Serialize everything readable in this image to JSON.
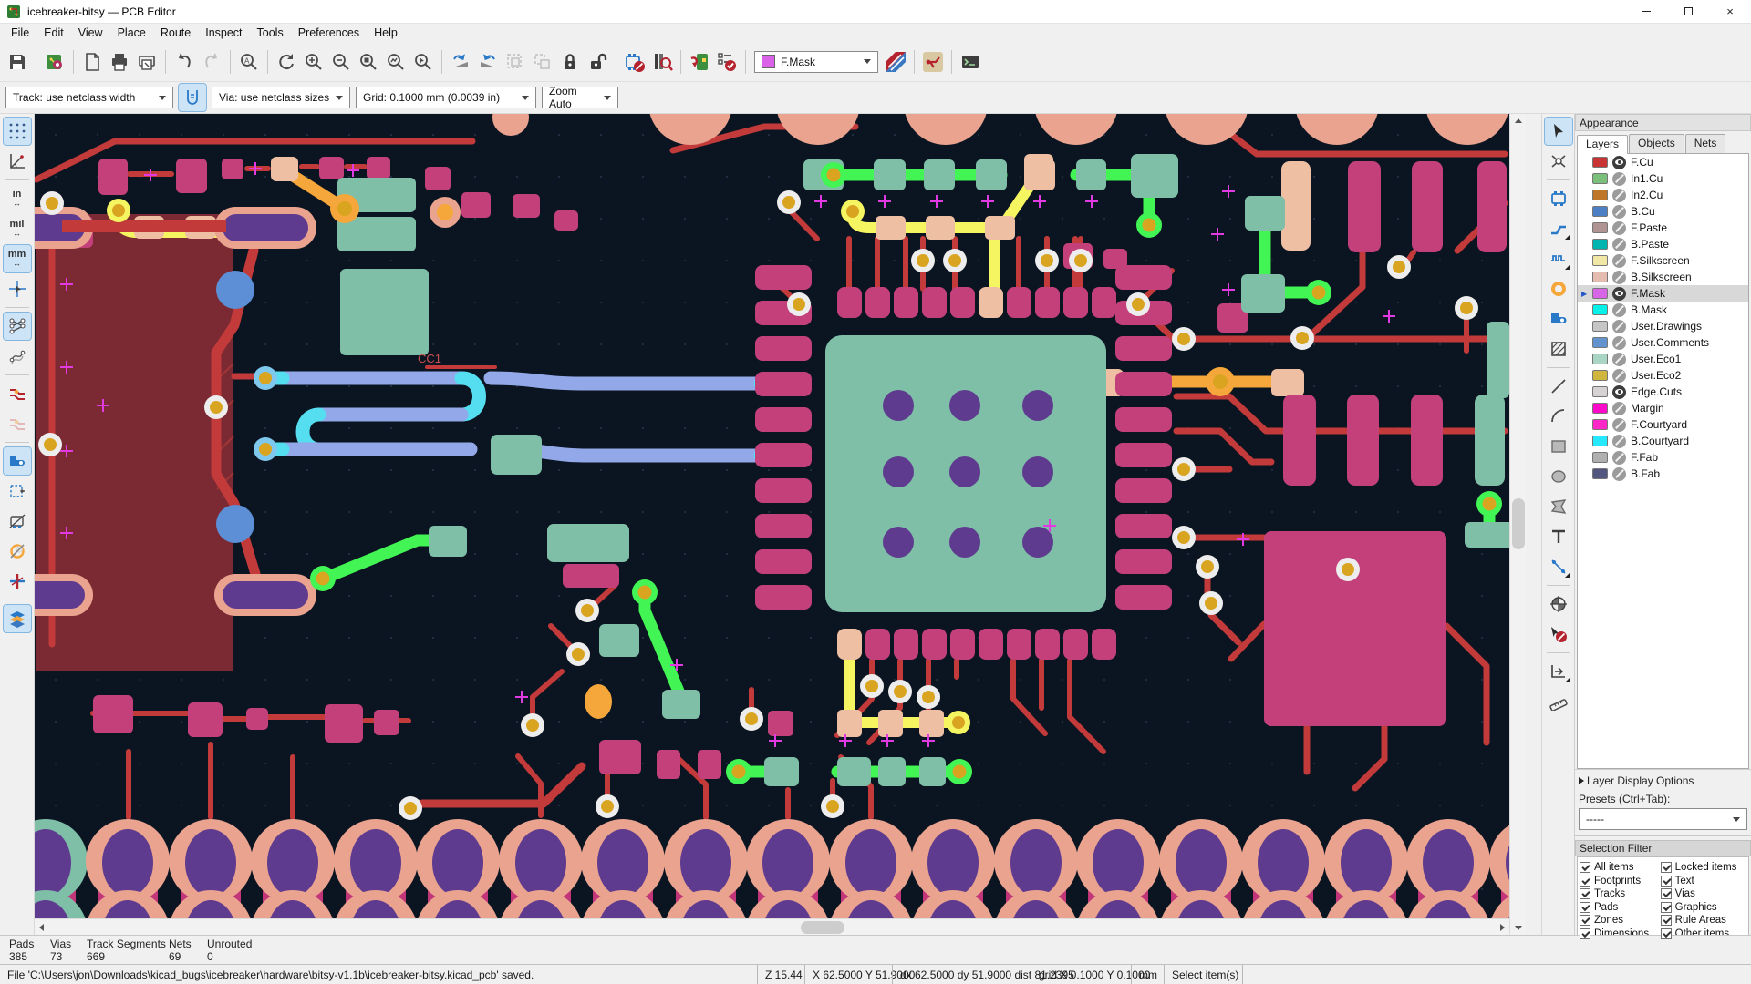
{
  "window": {
    "title": "icebreaker-bitsy — PCB Editor"
  },
  "menubar": {
    "items": [
      "File",
      "Edit",
      "View",
      "Place",
      "Route",
      "Inspect",
      "Tools",
      "Preferences",
      "Help"
    ]
  },
  "toolbar1": {
    "layer_selector": "F.Mask",
    "layer_selector_color": "#DA62E8"
  },
  "toolbar2": {
    "track": "Track: use netclass width",
    "via": "Via: use netclass sizes",
    "grid": "Grid: 0.1000 mm (0.0039 in)",
    "zoom": "Zoom Auto"
  },
  "left_toolbar": {
    "inches": "in",
    "mils": "mil",
    "mm": "mm"
  },
  "canvas": {
    "cc1_label": "CC1",
    "colors": {
      "bg": "#0B1421",
      "red": "#C23A3A",
      "zone": "#7B2A33",
      "pink": "#C4407B",
      "salmon": "#E9A38F",
      "salmonL": "#EFBFA4",
      "teal": "#7FBFA8",
      "purple": "#5F3B8F",
      "yellow": "#F5F562",
      "green": "#42F554",
      "orange": "#F5A73B",
      "peri": "#92A8E8",
      "cyan": "#55DDF0",
      "viaring": "#EDEDED",
      "viacore": "#D9A420",
      "bluepad": "#5C8FD6",
      "cross": "#E23AE2",
      "wedge": "#C23579",
      "gridd": "#22334A"
    }
  },
  "appearance": {
    "title": "Appearance",
    "tab_layers": "Layers",
    "tab_objects": "Objects",
    "tab_nets": "Nets",
    "layers": [
      {
        "name": "F.Cu",
        "color": "#C83434",
        "visible": true
      },
      {
        "name": "In1.Cu",
        "color": "#7ABF7A",
        "visible": false
      },
      {
        "name": "In2.Cu",
        "color": "#BE7628",
        "visible": false
      },
      {
        "name": "B.Cu",
        "color": "#4D7FC4",
        "visible": false
      },
      {
        "name": "F.Paste",
        "color": "#B09494",
        "visible": false
      },
      {
        "name": "B.Paste",
        "color": "#00B5B0",
        "visible": false
      },
      {
        "name": "F.Silkscreen",
        "color": "#F0E7A7",
        "visible": false
      },
      {
        "name": "B.Silkscreen",
        "color": "#E5BDB0",
        "visible": false
      },
      {
        "name": "F.Mask",
        "color": "#D864E8",
        "visible": true,
        "selected": true
      },
      {
        "name": "B.Mask",
        "color": "#00F2E8",
        "visible": false
      },
      {
        "name": "User.Drawings",
        "color": "#C5C5C5",
        "visible": false
      },
      {
        "name": "User.Comments",
        "color": "#6393CE",
        "visible": false
      },
      {
        "name": "User.Eco1",
        "color": "#A8D5C4",
        "visible": false
      },
      {
        "name": "User.Eco2",
        "color": "#D0B63E",
        "visible": false
      },
      {
        "name": "Edge.Cuts",
        "color": "#D6D2D4",
        "visible": true
      },
      {
        "name": "Margin",
        "color": "#FF0ACB",
        "visible": false
      },
      {
        "name": "F.Courtyard",
        "color": "#FF26C8",
        "visible": false
      },
      {
        "name": "B.Courtyard",
        "color": "#26E9FF",
        "visible": false
      },
      {
        "name": "F.Fab",
        "color": "#AFAFAF",
        "visible": false
      },
      {
        "name": "B.Fab",
        "color": "#51577F",
        "visible": false
      }
    ],
    "layer_display_options": "Layer Display Options",
    "presets_label": "Presets (Ctrl+Tab):",
    "presets_value": "-----"
  },
  "selection_filter": {
    "title": "Selection Filter",
    "items": [
      {
        "label": "All items",
        "checked": true
      },
      {
        "label": "Footprints",
        "checked": true
      },
      {
        "label": "Tracks",
        "checked": true
      },
      {
        "label": "Pads",
        "checked": true
      },
      {
        "label": "Zones",
        "checked": true
      },
      {
        "label": "Dimensions",
        "checked": true
      },
      {
        "label": "Locked items",
        "checked": true
      },
      {
        "label": "Text",
        "checked": true
      },
      {
        "label": "Vias",
        "checked": true
      },
      {
        "label": "Graphics",
        "checked": true
      },
      {
        "label": "Rule Areas",
        "checked": true
      },
      {
        "label": "Other items",
        "checked": true
      }
    ]
  },
  "statusbar": {
    "stats": [
      {
        "label": "Pads",
        "value": "385"
      },
      {
        "label": "Vias",
        "value": "73"
      },
      {
        "label": "Track Segments",
        "value": "669"
      },
      {
        "label": "Nets",
        "value": "69"
      },
      {
        "label": "Unrouted",
        "value": "0"
      }
    ],
    "message": "File 'C:\\Users\\jon\\Downloads\\kicad_bugs\\icebreaker\\hardware\\bitsy-v1.1b\\icebreaker-bitsy.kicad_pcb' saved.",
    "zoom": "Z 15.44",
    "position": "X 62.5000  Y 51.9000",
    "delta": "dx 62.5000  dy 51.9000  dist 81.2395",
    "grid": "grid X 0.1000  Y 0.1000",
    "units": "mm",
    "hint": "Select item(s)"
  }
}
